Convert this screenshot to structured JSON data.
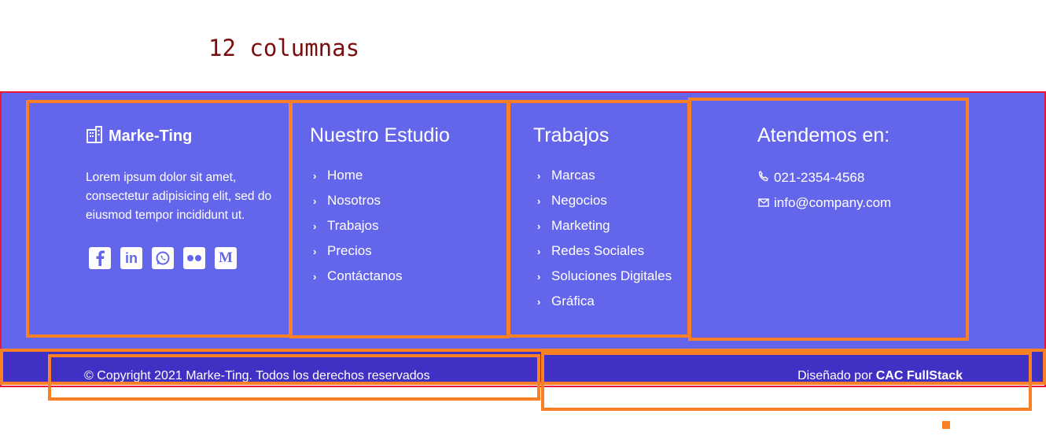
{
  "heading": "12 columnas",
  "brand": {
    "name": "Marke-Ting",
    "icon": "building-icon"
  },
  "about": "Lorem ipsum dolor sit amet, consectetur adipisicing elit, sed do eiusmod tempor incididunt ut.",
  "socials": [
    {
      "name": "facebook",
      "glyph": "f"
    },
    {
      "name": "linkedin",
      "glyph": "in"
    },
    {
      "name": "whatsapp",
      "glyph": "✆"
    },
    {
      "name": "flickr",
      "glyph": "••"
    },
    {
      "name": "medium",
      "glyph": "M"
    }
  ],
  "studio": {
    "title": "Nuestro Estudio",
    "items": [
      "Home",
      "Nosotros",
      "Trabajos",
      "Precios",
      "Contáctanos"
    ]
  },
  "works": {
    "title": "Trabajos",
    "items": [
      "Marcas",
      "Negocios",
      "Marketing",
      "Redes Sociales",
      "Soluciones Digitales",
      "Gráfica"
    ]
  },
  "contact": {
    "title": "Atendemos en:",
    "phone": "021-2354-4568",
    "email": "info@company.com"
  },
  "footer": {
    "copyright": "© Copyright 2021 Marke-Ting. Todos los derechos reservados",
    "designed_prefix": "Diseñado por",
    "designed_by": "CAC FullStack"
  },
  "colors": {
    "panel": "#6366ea",
    "bottom_bar": "#4130c4",
    "outline_orange": "#fb7f25",
    "outline_red": "#e8173a",
    "heading": "#7a0d0d"
  }
}
